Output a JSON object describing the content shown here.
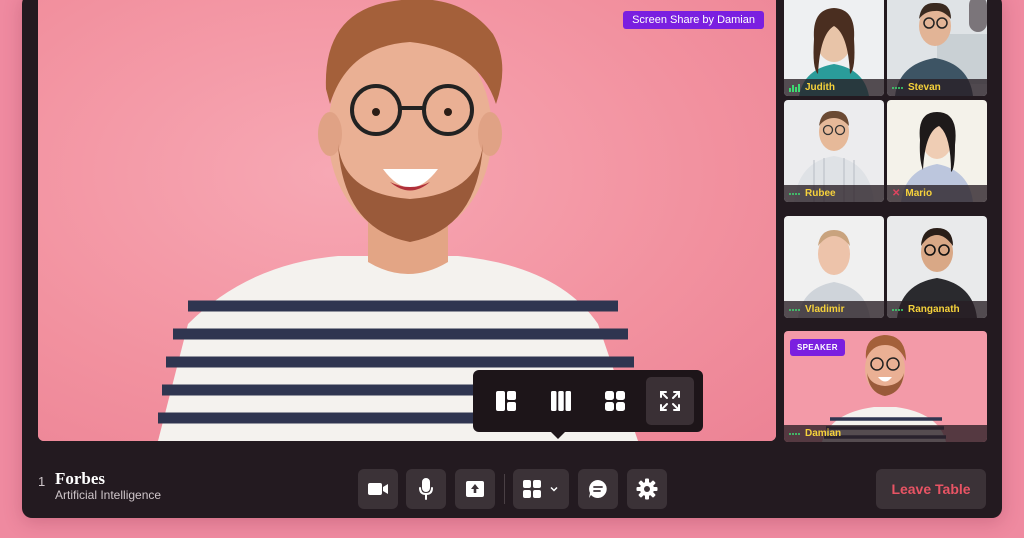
{
  "stage": {
    "share_label": "Screen Share by Damian"
  },
  "participants": [
    {
      "name": "Judith",
      "audio": "bars"
    },
    {
      "name": "Stevan",
      "audio": "dots"
    },
    {
      "name": "Rubee",
      "audio": "dots"
    },
    {
      "name": "Mario",
      "audio": "muted"
    },
    {
      "name": "Vladimir",
      "audio": "dots"
    },
    {
      "name": "Ranganath",
      "audio": "dots"
    },
    {
      "name": "Damian",
      "audio": "dots",
      "badge": "SPEAKER"
    }
  ],
  "view_options": [
    "sidebar-layout-icon",
    "columns-layout-icon",
    "grid-layout-icon",
    "fullscreen-icon"
  ],
  "event": {
    "page_number": "1",
    "brand": "Forbes",
    "topic": "Artificial Intelligence"
  },
  "controls": [
    "camera-icon",
    "microphone-icon",
    "share-screen-icon",
    "layout-icon",
    "chat-icon",
    "settings-icon"
  ],
  "leave_label": "Leave Table",
  "colors": {
    "accent_purple": "#7a1fe0",
    "name_yellow": "#f6d23b",
    "leave_red": "#e85464",
    "background_pink": "#ef8aa0"
  }
}
